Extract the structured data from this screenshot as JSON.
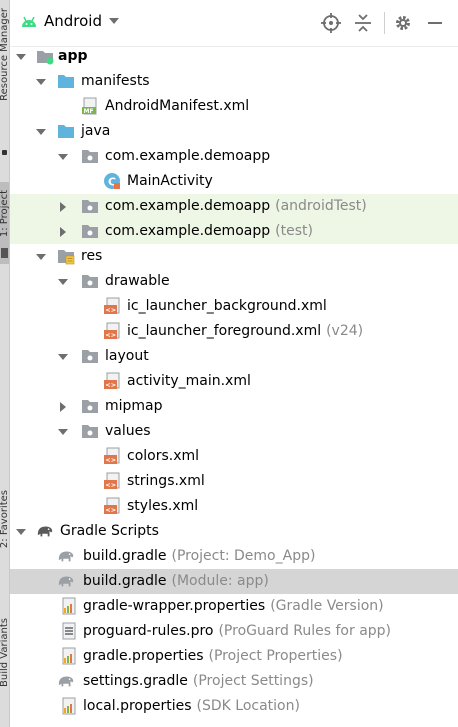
{
  "side_tabs": {
    "resource_manager": "Resource Manager",
    "project": "1: Project",
    "favorites": "2: Favorites",
    "build_variants": "Build Variants"
  },
  "toolbar": {
    "view_label": "Android",
    "icons": [
      "android-icon",
      "dropdown-arrow-icon",
      "locate-icon",
      "collapse-all-icon",
      "gear-icon",
      "minimize-icon"
    ]
  },
  "tree": [
    {
      "label": "app",
      "hint": "",
      "expanded": true,
      "icon": "module-folder-icon"
    },
    {
      "label": "manifests",
      "hint": "",
      "expanded": true,
      "icon": "folder-icon"
    },
    {
      "label": "AndroidManifest.xml",
      "hint": "",
      "icon": "manifest-file-icon"
    },
    {
      "label": "java",
      "hint": "",
      "expanded": true,
      "icon": "folder-icon"
    },
    {
      "label": "com.example.demoapp",
      "hint": "",
      "expanded": true,
      "icon": "package-icon"
    },
    {
      "label": "MainActivity",
      "hint": "",
      "icon": "kotlin-class-icon"
    },
    {
      "label": "com.example.demoapp",
      "hint": "(androidTest)",
      "expanded": false,
      "icon": "package-icon"
    },
    {
      "label": "com.example.demoapp",
      "hint": "(test)",
      "expanded": false,
      "icon": "package-icon"
    },
    {
      "label": "res",
      "hint": "",
      "expanded": true,
      "icon": "res-folder-icon"
    },
    {
      "label": "drawable",
      "hint": "",
      "expanded": true,
      "icon": "package-icon"
    },
    {
      "label": "ic_launcher_background.xml",
      "hint": "",
      "icon": "xml-file-icon"
    },
    {
      "label": "ic_launcher_foreground.xml",
      "hint": "(v24)",
      "icon": "xml-file-icon"
    },
    {
      "label": "layout",
      "hint": "",
      "expanded": true,
      "icon": "package-icon"
    },
    {
      "label": "activity_main.xml",
      "hint": "",
      "icon": "xml-file-icon"
    },
    {
      "label": "mipmap",
      "hint": "",
      "expanded": false,
      "icon": "package-icon"
    },
    {
      "label": "values",
      "hint": "",
      "expanded": true,
      "icon": "package-icon"
    },
    {
      "label": "colors.xml",
      "hint": "",
      "icon": "xml-file-icon"
    },
    {
      "label": "strings.xml",
      "hint": "",
      "icon": "xml-file-icon"
    },
    {
      "label": "styles.xml",
      "hint": "",
      "icon": "xml-file-icon"
    },
    {
      "label": "Gradle Scripts",
      "hint": "",
      "expanded": true,
      "icon": "gradle-elephant-icon"
    },
    {
      "label": "build.gradle",
      "hint": "(Project: Demo_App)",
      "icon": "gradle-file-icon"
    },
    {
      "label": "build.gradle",
      "hint": "(Module: app)",
      "icon": "gradle-file-icon",
      "selected": true
    },
    {
      "label": "gradle-wrapper.properties",
      "hint": "(Gradle Version)",
      "icon": "properties-file-icon"
    },
    {
      "label": "proguard-rules.pro",
      "hint": "(ProGuard Rules for app)",
      "icon": "text-file-icon"
    },
    {
      "label": "gradle.properties",
      "hint": "(Project Properties)",
      "icon": "properties-file-icon"
    },
    {
      "label": "settings.gradle",
      "hint": "(Project Settings)",
      "icon": "gradle-file-icon"
    },
    {
      "label": "local.properties",
      "hint": "(SDK Location)",
      "icon": "properties-file-icon"
    }
  ],
  "colors": {
    "folder_blue": "#5fb4de",
    "package_gray": "#9aa0a6",
    "xml_orange": "#e0764a",
    "selection_gray": "#d5d5d5",
    "test_green": "#eef6e5",
    "android_green": "#3ddc84"
  }
}
